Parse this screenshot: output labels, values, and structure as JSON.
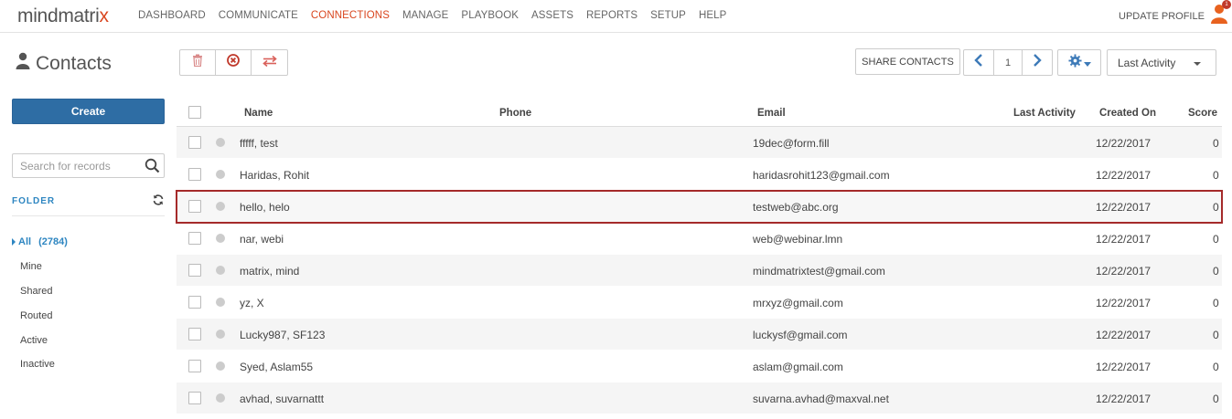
{
  "app": {
    "logo_main": "mindmatri",
    "logo_accent": "x",
    "nav": [
      "DASHBOARD",
      "COMMUNICATE",
      "CONNECTIONS",
      "MANAGE",
      "PLAYBOOK",
      "ASSETS",
      "REPORTS",
      "SETUP",
      "HELP"
    ],
    "nav_active": "CONNECTIONS",
    "update_profile": "UPDATE PROFILE",
    "notification_count": "1",
    "accent_color": "#d9461f"
  },
  "page": {
    "title": "Contacts"
  },
  "toolbar": {
    "share_label": "SHARE CONTACTS",
    "page_number": "1",
    "sort_value": "Last Activity"
  },
  "sidebar": {
    "create_label": "Create",
    "search_placeholder": "Search for records",
    "folder_label": "FOLDER",
    "folders": [
      {
        "label": "All",
        "count": "(2784)"
      },
      {
        "label": "Mine"
      },
      {
        "label": "Shared"
      },
      {
        "label": "Routed"
      },
      {
        "label": "Active"
      },
      {
        "label": "Inactive"
      }
    ]
  },
  "table": {
    "headers": {
      "name": "Name",
      "phone": "Phone",
      "email": "Email",
      "last_activity": "Last Activity",
      "created_on": "Created On",
      "score": "Score"
    },
    "rows": [
      {
        "name": "fffff, test",
        "phone": "",
        "email": "19dec@form.fill",
        "last_activity": "",
        "created_on": "12/22/2017",
        "score": "0"
      },
      {
        "name": "Haridas, Rohit",
        "phone": "",
        "email": "haridasrohit123@gmail.com",
        "last_activity": "",
        "created_on": "12/22/2017",
        "score": "0"
      },
      {
        "name": "hello, helo",
        "phone": "",
        "email": "testweb@abc.org",
        "last_activity": "",
        "created_on": "12/22/2017",
        "score": "0"
      },
      {
        "name": "nar, webi",
        "phone": "",
        "email": "web@webinar.lmn",
        "last_activity": "",
        "created_on": "12/22/2017",
        "score": "0"
      },
      {
        "name": "matrix, mind",
        "phone": "",
        "email": "mindmatrixtest@gmail.com",
        "last_activity": "",
        "created_on": "12/22/2017",
        "score": "0"
      },
      {
        "name": "yz, X",
        "phone": "",
        "email": "mrxyz@gmail.com",
        "last_activity": "",
        "created_on": "12/22/2017",
        "score": "0"
      },
      {
        "name": "Lucky987, SF123",
        "phone": "",
        "email": "luckysf@gmail.com",
        "last_activity": "",
        "created_on": "12/22/2017",
        "score": "0"
      },
      {
        "name": "Syed, Aslam55",
        "phone": "",
        "email": "aslam@gmail.com",
        "last_activity": "",
        "created_on": "12/22/2017",
        "score": "0"
      },
      {
        "name": "avhad, suvarnattt",
        "phone": "",
        "email": "suvarna.avhad@maxval.net",
        "last_activity": "",
        "created_on": "12/22/2017",
        "score": "0"
      }
    ]
  }
}
